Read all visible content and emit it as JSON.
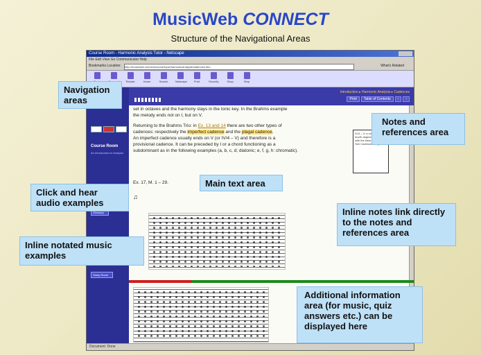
{
  "slide": {
    "title_main": "MusicWeb ",
    "title_italic": "CONNECT",
    "subtitle": "Structure of the Navigational Areas"
  },
  "browser": {
    "window_title": "Course Room - Harmonic Analysis Tutor - Netscape",
    "menu": "File  Edit  View  Go  Communicator  Help",
    "address_label": "Bookmarks   Location:",
    "address_value": "http://musicweb.connect/course/topic/harmonicanalysis/cadences.htm",
    "links": "What's Related",
    "toolbar": [
      "Back",
      "Forward",
      "Reload",
      "Home",
      "Search",
      "Netscape",
      "Print",
      "Security",
      "Shop",
      "Stop"
    ],
    "status": "Document: Done"
  },
  "sidebar": {
    "title": "Course Room",
    "subtitle": "An Introduction to Analysis",
    "items": [
      "Contents",
      "Notes",
      "Glossary",
      "Links",
      "Study Room"
    ]
  },
  "topstrip": {
    "links": "Introduction  ▸  Harmonic Analysis  ▸  Cadences",
    "buttons": [
      "Print",
      "Table of Contents",
      "‹",
      "›"
    ]
  },
  "content": {
    "line0": "set in octaves and the harmony stays in the tonic key. In the Brahms example",
    "line0b": "the melody ends not on I, but on V.",
    "para1_a": "Returning to the Brahms Trio: in ",
    "para1_link": "Ex. 13 and 14",
    "para1_b": " there are two other types of",
    "para1_c": "cadences: respectively the ",
    "para1_hl1": "imperfect cadence",
    "para1_d": " and the ",
    "para1_hl2": "plagal cadence",
    "para1_e": ".",
    "para1_f": "An imperfect cadence usually ends on V (or IV/4 – V) and therefore is a",
    "para1_g": "provisional cadence. It can be preceded by I or a chord functioning as a",
    "para1_h": "subdominant as in the following examples (a, b, c, d; diatonic; e, f, g, h: chromatic).",
    "example_ref": "Ex. 17, M. 1 – 29.",
    "notes_box": "IV/4 – V: a chord on the fourth degree of the scale with the bass note on V. See Cadences diagram."
  },
  "callouts": {
    "navigation": "Navigation areas",
    "notes": "Notes and references area",
    "main_text": "Main text area",
    "audio": "Click and hear audio examples",
    "inline_notes": "Inline notes link directly to the notes and references area",
    "notated": "Inline notated music examples",
    "additional": "Additional information area (for music, quiz answers etc.) can be displayed here"
  }
}
